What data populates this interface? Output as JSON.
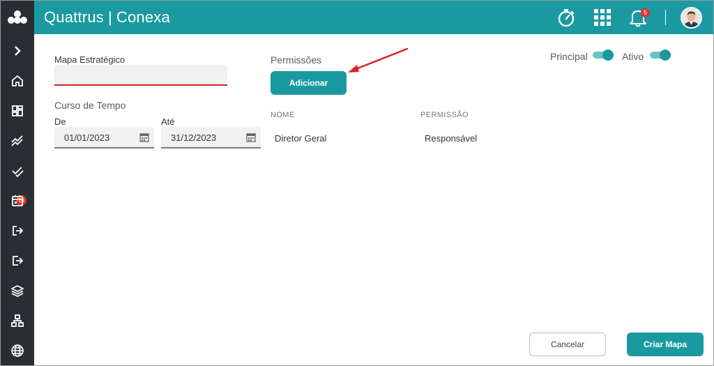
{
  "colors": {
    "accent": "#1a9aa0",
    "sidebar": "#2a2e33",
    "error": "#c62828",
    "badge": "#e0312f",
    "arrow": "#e02020"
  },
  "header": {
    "brand": "Quattrus",
    "separator": "|",
    "product": "Conexa",
    "icons": [
      "timer-icon",
      "apps-grid-icon",
      "bell-icon",
      "avatar"
    ],
    "notification_count": "5"
  },
  "sidebar": {
    "items": [
      {
        "icon": "chevron-right-icon"
      },
      {
        "icon": "home-icon"
      },
      {
        "icon": "dashboard-icon"
      },
      {
        "icon": "trend-icon"
      },
      {
        "icon": "tasks-icon",
        "badge": "16"
      },
      {
        "icon": "calendar-icon"
      },
      {
        "icon": "login-icon"
      },
      {
        "icon": "logout-icon"
      },
      {
        "icon": "layers-icon"
      },
      {
        "icon": "hierarchy-icon"
      },
      {
        "icon": "globe-icon"
      }
    ]
  },
  "form": {
    "map_label": "Mapa Estratégico",
    "map_value": "",
    "time_label": "Curso de Tempo",
    "from_label": "De",
    "from_value": "01/01/2023",
    "to_label": "Até",
    "to_value": "31/12/2023"
  },
  "permissions": {
    "title": "Permissões",
    "add_label": "Adicionar",
    "columns": [
      "NOME",
      "PERMISSÃO"
    ],
    "rows": [
      {
        "name": "Diretor Geral",
        "permission": "Responsável"
      }
    ]
  },
  "toggles": {
    "principal_label": "Principal",
    "principal_on": true,
    "active_label": "Ativo",
    "active_on": true
  },
  "footer": {
    "cancel_label": "Cancelar",
    "create_label": "Criar Mapa"
  }
}
